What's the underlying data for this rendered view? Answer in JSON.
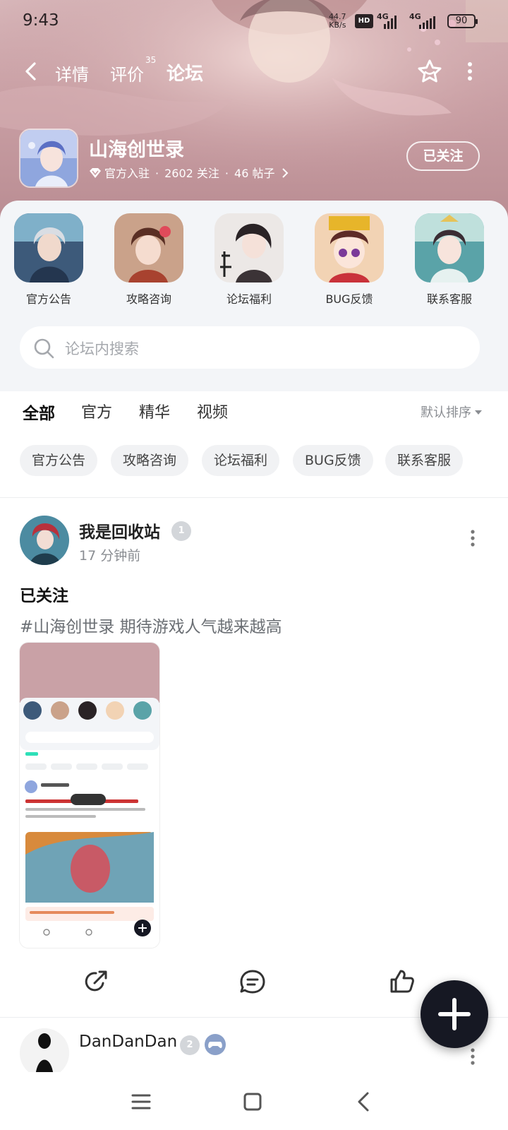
{
  "status_bar": {
    "time": "9:43",
    "net_speed_value": "44.7",
    "net_speed_unit": "KB/s",
    "hd_label": "HD",
    "sim1_label": "4G",
    "sim2_label": "4G",
    "battery": "90"
  },
  "nav": {
    "tabs": [
      {
        "label": "详情"
      },
      {
        "label": "评价",
        "sup": "35"
      },
      {
        "label": "论坛",
        "active": true
      }
    ],
    "icons": [
      "back-icon",
      "star-icon",
      "more-vertical-icon"
    ]
  },
  "game": {
    "name": "山海创世录",
    "official": "官方入驻",
    "followers": "2602 关注",
    "posts": "46 帖子",
    "follow_button": "已关注"
  },
  "boards": [
    {
      "label": "官方公告"
    },
    {
      "label": "攻略咨询"
    },
    {
      "label": "论坛福利"
    },
    {
      "label": "BUG反馈"
    },
    {
      "label": "联系客服"
    }
  ],
  "search": {
    "placeholder": "论坛内搜索"
  },
  "filter_tabs": [
    "全部",
    "官方",
    "精华",
    "视频"
  ],
  "sort_label": "默认排序",
  "chips": [
    "官方公告",
    "攻略咨询",
    "论坛福利",
    "BUG反馈",
    "联系客服"
  ],
  "post": {
    "author": "我是回收站",
    "level": "1",
    "time": "17 分钟前",
    "title": "已关注",
    "text": "#山海创世录 期待游戏人气越来越高"
  },
  "post2": {
    "author": "DanDanDan",
    "level": "2"
  },
  "colors": {
    "accent": "#2ee0b8",
    "header_bg": "#c99fa4"
  }
}
